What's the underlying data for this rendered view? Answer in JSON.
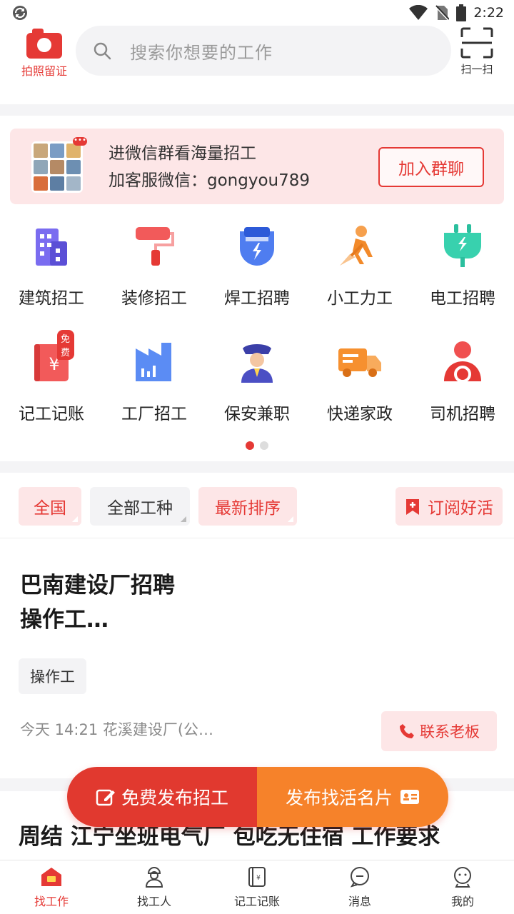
{
  "status_bar": {
    "time": "2:22"
  },
  "header": {
    "camera_label": "拍照留证",
    "search_placeholder": "搜索你想要的工作",
    "scan_label": "扫一扫"
  },
  "banner": {
    "line1": "进微信群看海量招工",
    "line2": "加客服微信：gongyou789",
    "join_button": "加入群聊",
    "dots": "•••"
  },
  "categories": [
    {
      "label": "建筑招工",
      "icon": "building-icon"
    },
    {
      "label": "装修招工",
      "icon": "paint-roller-icon"
    },
    {
      "label": "焊工招聘",
      "icon": "welding-mask-icon"
    },
    {
      "label": "小工力工",
      "icon": "laborer-icon"
    },
    {
      "label": "电工招聘",
      "icon": "electric-plug-icon"
    },
    {
      "label": "记工记账",
      "icon": "ledger-icon",
      "badge": "免费"
    },
    {
      "label": "工厂招工",
      "icon": "factory-icon"
    },
    {
      "label": "保安兼职",
      "icon": "security-guard-icon"
    },
    {
      "label": "快递家政",
      "icon": "delivery-truck-icon"
    },
    {
      "label": "司机招聘",
      "icon": "driver-icon"
    }
  ],
  "filters": {
    "region": "全国",
    "job_type": "全部工种",
    "sort": "最新排序",
    "subscribe": "订阅好活"
  },
  "job1": {
    "title": "巴南建设厂招聘\n 操作工…",
    "tag": "操作工",
    "meta": "今天  14:21 花溪建设厂(公…",
    "contact": "联系老板"
  },
  "job2": {
    "title": "周结 江宁坐班电气厂 包吃无住宿 工作要求"
  },
  "fab": {
    "post_job": "免费发布招工",
    "post_card": "发布找活名片"
  },
  "bottom_nav": [
    {
      "label": "找工作",
      "icon": "home-job-icon",
      "active": true
    },
    {
      "label": "找工人",
      "icon": "worker-icon"
    },
    {
      "label": "记工记账",
      "icon": "ledger-book-icon"
    },
    {
      "label": "消息",
      "icon": "message-icon"
    },
    {
      "label": "我的",
      "icon": "profile-icon"
    }
  ],
  "colors": {
    "accent": "#e53935",
    "orange": "#f6822a",
    "pink_bg": "#fde6e7"
  }
}
